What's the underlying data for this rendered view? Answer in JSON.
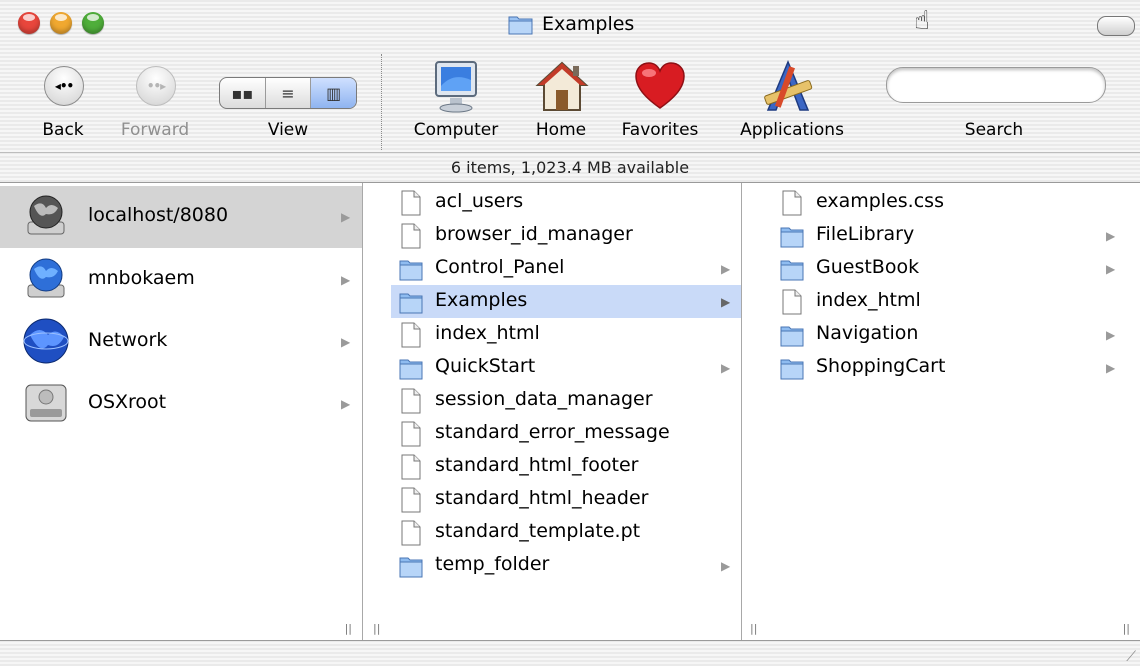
{
  "window": {
    "title": "Examples",
    "colors": {
      "close": "#e8463c",
      "minimize": "#f0a830",
      "zoom": "#4fae3a",
      "selection": "#c9daf8"
    }
  },
  "toolbar": {
    "back_label": "Back",
    "forward_label": "Forward",
    "view_label": "View",
    "computer_label": "Computer",
    "home_label": "Home",
    "favorites_label": "Favorites",
    "applications_label": "Applications",
    "search_label": "Search",
    "view_modes": [
      "icon-view-icon",
      "list-view-icon",
      "column-view-icon"
    ],
    "active_view": "column"
  },
  "status": {
    "text": "6 items, 1,023.4 MB available"
  },
  "volumes": [
    {
      "label": "localhost/8080",
      "icon": "globe-server-icon",
      "selected": true
    },
    {
      "label": "mnbokaem",
      "icon": "globe-server-icon",
      "selected": false
    },
    {
      "label": "Network",
      "icon": "network-globe-icon",
      "selected": false
    },
    {
      "label": "OSXroot",
      "icon": "hard-drive-icon",
      "selected": false
    }
  ],
  "column2": [
    {
      "label": "acl_users",
      "type": "file"
    },
    {
      "label": "browser_id_manager",
      "type": "file"
    },
    {
      "label": "Control_Panel",
      "type": "folder"
    },
    {
      "label": "Examples",
      "type": "folder",
      "selected": true
    },
    {
      "label": "index_html",
      "type": "file"
    },
    {
      "label": "QuickStart",
      "type": "folder"
    },
    {
      "label": "session_data_manager",
      "type": "file"
    },
    {
      "label": "standard_error_message",
      "type": "file"
    },
    {
      "label": "standard_html_footer",
      "type": "file"
    },
    {
      "label": "standard_html_header",
      "type": "file"
    },
    {
      "label": "standard_template.pt",
      "type": "file"
    },
    {
      "label": "temp_folder",
      "type": "folder"
    }
  ],
  "column3": [
    {
      "label": "examples.css",
      "type": "file"
    },
    {
      "label": "FileLibrary",
      "type": "folder"
    },
    {
      "label": "GuestBook",
      "type": "folder"
    },
    {
      "label": "index_html",
      "type": "file"
    },
    {
      "label": "Navigation",
      "type": "folder"
    },
    {
      "label": "ShoppingCart",
      "type": "folder"
    }
  ]
}
